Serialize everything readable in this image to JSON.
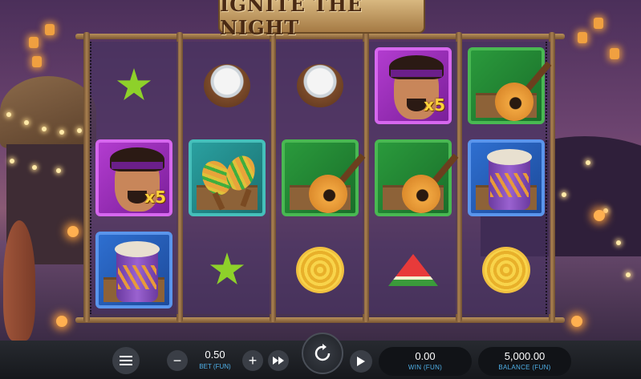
{
  "game": {
    "title": "IGNITE THE NIGHT"
  },
  "reels": [
    [
      "star-fruit",
      "drummer-x5",
      "drum"
    ],
    [
      "coconut",
      "maracas",
      "star-fruit"
    ],
    [
      "coconut",
      "guitar",
      "pineapple"
    ],
    [
      "drummer-x5",
      "guitar",
      "watermelon"
    ],
    [
      "guitar",
      "drum",
      "pineapple"
    ]
  ],
  "multiplier_label": "x5",
  "controls": {
    "bet_value": "0.50",
    "bet_label": "BET (FUN)",
    "win_value": "0.00",
    "win_label": "WIN (FUN)",
    "balance_value": "5,000.00",
    "balance_label": "BALANCE (FUN)",
    "minus_symbol": "−",
    "plus_symbol": "+",
    "menu_icon": "hamburger-menu-icon",
    "spin_icon": "spin-arrow-icon",
    "autoplay_icon": "play-icon",
    "turbo_icon": "fast-forward-icon"
  },
  "colors": {
    "accent_blue": "#4fb0e8",
    "panel": "#111317"
  }
}
